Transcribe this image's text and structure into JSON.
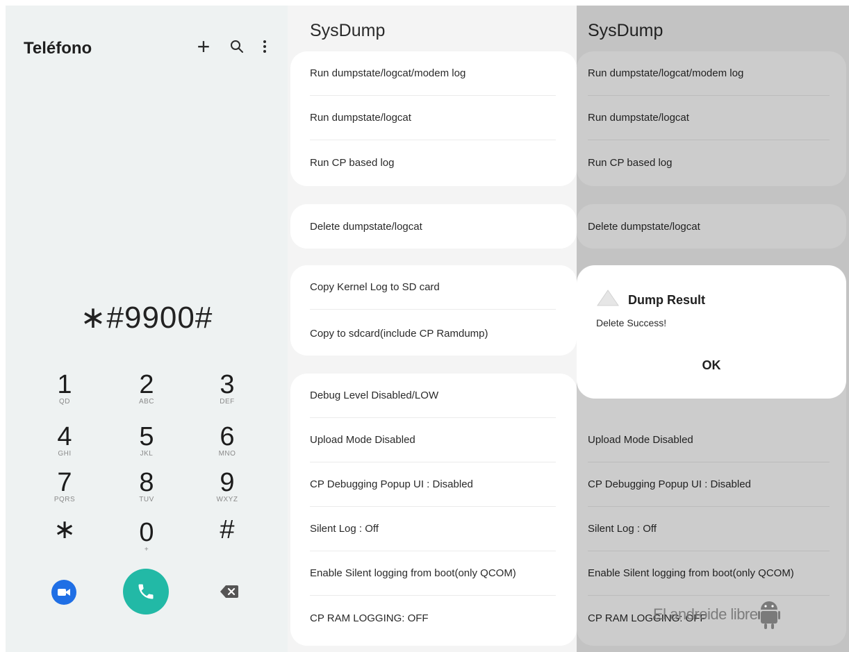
{
  "dialer": {
    "title": "Teléfono",
    "dialed_number": "∗#9900#",
    "keys": [
      {
        "digit": "1",
        "letters": "QD"
      },
      {
        "digit": "2",
        "letters": "ABC"
      },
      {
        "digit": "3",
        "letters": "DEF"
      },
      {
        "digit": "4",
        "letters": "GHI"
      },
      {
        "digit": "5",
        "letters": "JKL"
      },
      {
        "digit": "6",
        "letters": "MNO"
      },
      {
        "digit": "7",
        "letters": "PQRS"
      },
      {
        "digit": "8",
        "letters": "TUV"
      },
      {
        "digit": "9",
        "letters": "WXYZ"
      },
      {
        "digit": "∗",
        "letters": ""
      },
      {
        "digit": "0",
        "letters": "+"
      },
      {
        "digit": "#",
        "letters": ""
      }
    ],
    "icons": {
      "add": "plus-icon",
      "search": "search-icon",
      "more": "more-vertical-icon",
      "video": "video-call-icon",
      "call": "phone-icon",
      "backspace": "backspace-icon"
    },
    "colors": {
      "call_button": "#22b9a6",
      "video_button": "#1f6fe5"
    }
  },
  "sysdump_main": {
    "title": "SysDump",
    "groups": [
      [
        "Run dumpstate/logcat/modem log",
        "Run dumpstate/logcat",
        "Run CP based log"
      ],
      [
        "Delete dumpstate/logcat"
      ],
      [
        "Copy Kernel Log to SD card",
        "Copy to sdcard(include CP Ramdump)"
      ],
      [
        "Debug Level Disabled/LOW",
        "Upload Mode Disabled",
        "CP Debugging Popup UI : Disabled",
        "Silent Log : Off",
        "Enable Silent logging from boot(only QCOM)",
        "CP RAM LOGGING: OFF"
      ]
    ]
  },
  "sysdump_dialog_screen": {
    "title": "SysDump",
    "groups": [
      [
        "Run dumpstate/logcat/modem log",
        "Run dumpstate/logcat",
        "Run CP based log"
      ],
      [
        "Delete dumpstate/logcat"
      ],
      [],
      [
        "Upload Mode Disabled",
        "CP Debugging Popup UI : Disabled",
        "Silent Log : Off",
        "Enable Silent logging from boot(only QCOM)",
        "CP RAM LOGGING: OFF"
      ]
    ],
    "dialog": {
      "title": "Dump Result",
      "message": "Delete Success!",
      "ok": "OK",
      "icon": "warning-triangle-icon"
    }
  },
  "watermark": {
    "text": "El androide libre",
    "icon": "android-robot-icon"
  }
}
